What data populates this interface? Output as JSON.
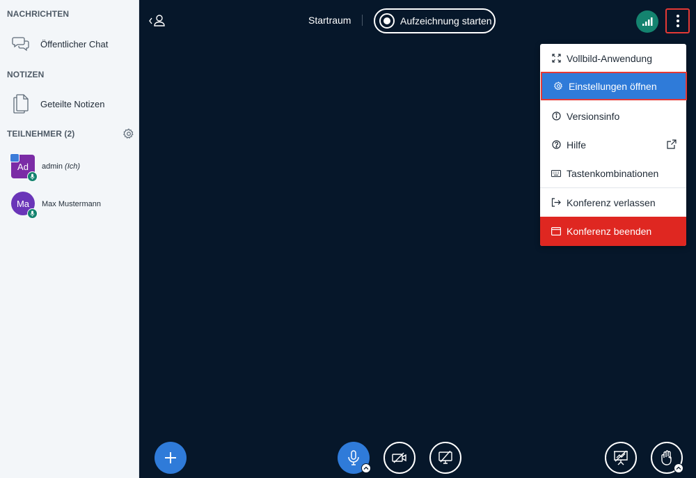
{
  "sidebar": {
    "messages_title": "NACHRICHTEN",
    "public_chat_label": "Öffentlicher Chat",
    "notes_title": "NOTIZEN",
    "shared_notes_label": "Geteilte Notizen",
    "participants_title": "TEILNEHMER (2)",
    "users": [
      {
        "initials": "Ad",
        "name": "admin",
        "suffix": "(Ich)"
      },
      {
        "initials": "Ma",
        "name": "Max Mustermann",
        "suffix": ""
      }
    ]
  },
  "header": {
    "room_title": "Startraum",
    "record_label": "Aufzeichnung starten"
  },
  "menu": {
    "items": [
      {
        "label": "Vollbild-Anwendung",
        "icon": "fullscreen-icon"
      },
      {
        "label": "Einstellungen öffnen",
        "icon": "gear-icon"
      },
      {
        "label": "Versionsinfo",
        "icon": "info-icon"
      },
      {
        "label": "Hilfe",
        "icon": "help-icon"
      },
      {
        "label": "Tastenkombinationen",
        "icon": "keyboard-icon"
      },
      {
        "label": "Konferenz verlassen",
        "icon": "logout-icon"
      },
      {
        "label": "Konferenz beenden",
        "icon": "end-conference-icon"
      }
    ]
  },
  "colors": {
    "main_bg": "#06172a",
    "accent_blue": "#2f7bd9",
    "danger_red": "#df2721",
    "mic_green": "#14836f"
  }
}
